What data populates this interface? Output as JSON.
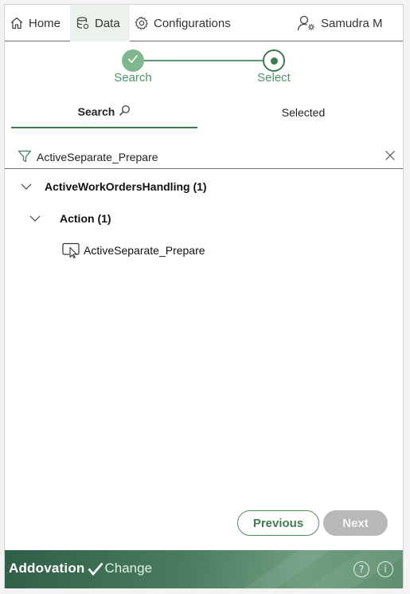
{
  "nav": {
    "home": "Home",
    "data": "Data",
    "configurations": "Configurations",
    "user": "Samudra M"
  },
  "stepper": {
    "steps": [
      {
        "label": "Search",
        "status": "complete"
      },
      {
        "label": "Select",
        "status": "current"
      }
    ]
  },
  "tabs": {
    "search": "Search",
    "selected": "Selected",
    "active": "search"
  },
  "filter": {
    "value": "ActiveSeparate_Prepare"
  },
  "tree": {
    "group": "ActiveWorkOrdersHandling (1)",
    "subgroup": "Action (1)",
    "item": "ActiveSeparate_Prepare"
  },
  "buttons": {
    "previous": "Previous",
    "next": "Next"
  },
  "footer": {
    "brand": "Addovation",
    "product": "Change",
    "help_icon": "?",
    "info_icon": "i"
  },
  "colors": {
    "accent": "#3f7a52",
    "step_complete": "#7fb78f",
    "disabled": "#b8b8b8"
  }
}
